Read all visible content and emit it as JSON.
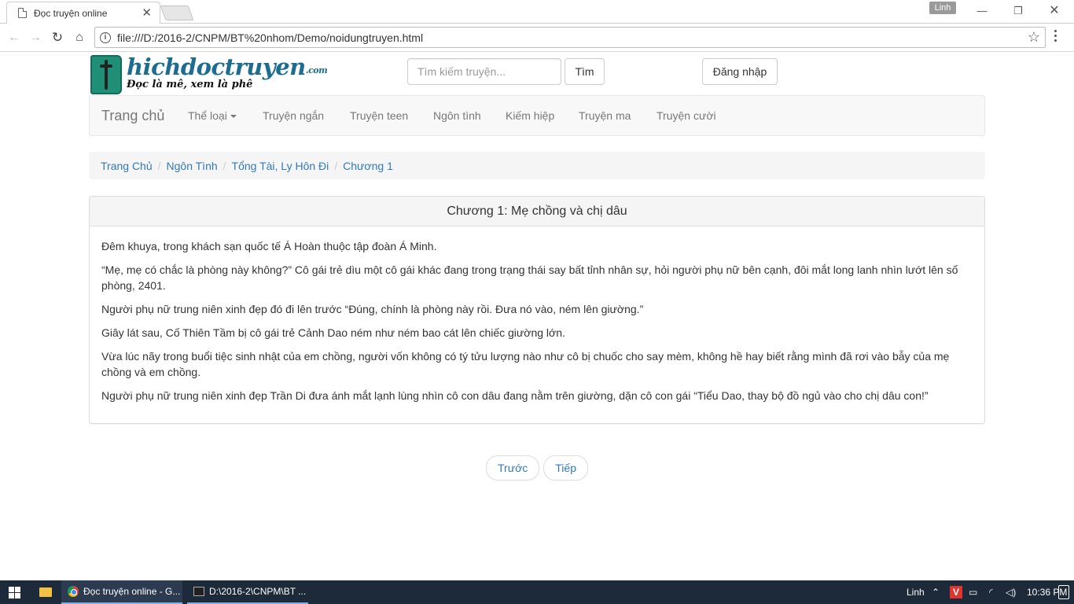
{
  "browser": {
    "tab_title": "Đọc truyện online",
    "profile_name": "Linh",
    "url": "file:///D:/2016-2/CNPM/BT%20nhom/Demo/noidungtruyen.html"
  },
  "header": {
    "logo_brand": "hichdoctruyen",
    "logo_domain": ".com",
    "logo_slogan": "Đọc là mê, xem là phê",
    "search_placeholder": "Tìm kiếm truyện...",
    "search_button": "Tìm",
    "login_button": "Đăng nhập"
  },
  "navbar": {
    "brand": "Trang chủ",
    "items": [
      {
        "label": "Thể loại",
        "dropdown": true
      },
      {
        "label": "Truyện ngắn"
      },
      {
        "label": "Truyện teen"
      },
      {
        "label": "Ngôn tình"
      },
      {
        "label": "Kiếm hiệp"
      },
      {
        "label": "Truyện ma"
      },
      {
        "label": "Truyện cười"
      }
    ]
  },
  "breadcrumb": [
    "Trang Chủ",
    "Ngôn Tình",
    "Tổng Tài, Ly Hôn Đi",
    "Chương 1"
  ],
  "chapter": {
    "title": "Chương 1: Mẹ chồng và chị dâu",
    "paragraphs": [
      "Đêm khuya, trong khách sạn quốc tế Á Hoàn thuộc tập đoàn Á Minh.",
      "“Mẹ, mẹ có chắc là phòng này không?” Cô gái trẻ dìu một cô gái khác đang trong trạng thái say bất tỉnh nhân sự, hỏi người phụ nữ bên cạnh, đôi mắt long lanh nhìn lướt lên số phòng, 2401.",
      "Người phụ nữ trung niên xinh đẹp đó đi lên trước “Đúng, chính là phòng này rồi. Đưa nó vào, ném lên giường.”",
      "Giây lát sau, Cố Thiên Tầm bị cô gái trẻ Cảnh Dao ném như ném bao cát lên chiếc giường lớn.",
      "Vừa lúc nãy trong buổi tiệc sinh nhật của em chồng, người vốn không có tý tửu lượng nào như cô bị chuốc cho say mèm, không hề hay biết rằng mình đã rơi vào bẫy của mẹ chồng và em chồng.",
      "Người phụ nữ trung niên xinh đẹp Trần Di đưa ánh mắt lạnh lùng nhìn cô con dâu đang nằm trên giường, dặn cô con gái “Tiểu Dao, thay bộ đồ ngủ vào cho chị dâu con!”"
    ]
  },
  "pager": {
    "prev": "Trước",
    "next": "Tiếp"
  },
  "taskbar": {
    "tasks": [
      {
        "label": "Đọc truyện online - G..."
      },
      {
        "label": "D:\\2016-2\\CNPM\\BT ..."
      }
    ],
    "tray_user": "Linh",
    "clock": "10:36 PM"
  },
  "colors": {
    "link": "#337ab7",
    "logo_teal": "#1f8f78",
    "taskbar": "#1d2a3a"
  }
}
